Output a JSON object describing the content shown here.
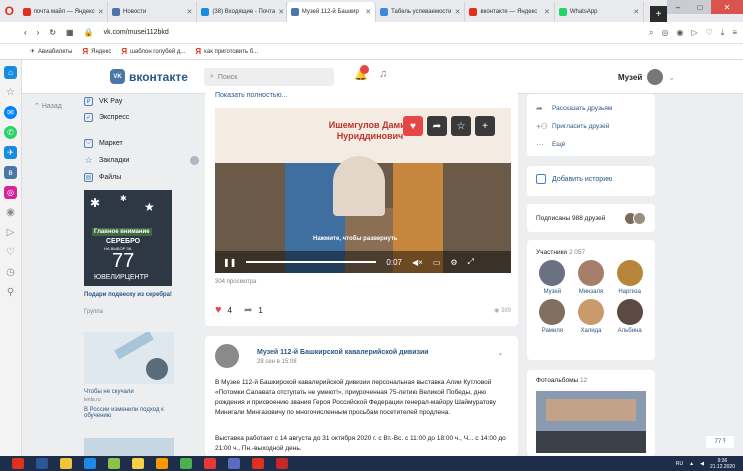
{
  "browser": {
    "tabs": [
      {
        "label": "почта майл — Яндекс",
        "active": false
      },
      {
        "label": "Новости",
        "active": false
      },
      {
        "label": "(38) Входящие - Почта",
        "active": false
      },
      {
        "label": "Музей 112-й Башкир",
        "active": true
      },
      {
        "label": "Табель успеваемости",
        "active": false
      },
      {
        "label": "вконтакте — Яндекс",
        "active": false
      },
      {
        "label": "WhatsApp",
        "active": false
      }
    ],
    "url": "vk.com/musei112bkd",
    "bookmarks": [
      "Авиабилеты",
      "Яндекс",
      "шаблон голубей д...",
      "как приготовить б..."
    ]
  },
  "vk": {
    "logo": "вконтакте",
    "search_placeholder": "Поиск",
    "user_name": "Музей"
  },
  "left_nav": {
    "back": "Назад",
    "items": [
      {
        "label": "VK Pay"
      },
      {
        "label": "Экспресс"
      },
      {
        "label": "Маркет"
      },
      {
        "label": "Закладки"
      },
      {
        "label": "Файлы"
      }
    ]
  },
  "ads": {
    "ad1": {
      "line1": "Главное внимание",
      "line2": "СЕРЕБРО",
      "line3": "НА ВЫБОР ЗА",
      "line4": "77",
      "line5": "ЮВЕЛИРЦЕНТР",
      "title": "Подари подвеску из серебра!",
      "sub": "Группа"
    },
    "ad2": {
      "title": "Чтобы не скучали",
      "sub": "lenta.ru"
    },
    "ad3": {
      "title": "В России изменили подход к обучению"
    }
  },
  "post1": {
    "show_more": "Показать полностью...",
    "video_name": "Ишемгулов Дамир Нуриддинович",
    "video_hint": "Нажмите, чтобы развернуть",
    "time": "0:07",
    "views": "304 просмотра",
    "likes": "4",
    "shares": "1",
    "eye_count": "389"
  },
  "post2": {
    "author": "Музей 112-й Башкирской кавалерийской дивизии",
    "date": "28 сен в 15:08",
    "text": "В Музее 112-й Башкирской кавалерийской дивизии персональная выставка Алии Кутловой «Потомки Салавата отступать не умеют!», приуроченная 75-летию Великой Победы, дню рождения и присвоению звания Героя Российской Федерации генерал-майору Шаймуратову Минигали Мингазовичу по многочисленным просьбам посетителей продлена.",
    "text2": "Выставка работает с 14 августа до 31 октября 2020 г. с Вт.-Вс. с 11:00 до 18:00 ч., Ч... с 14:00 до 21:00 ч., Пн.-выходной день."
  },
  "right": {
    "share": "Рассказать друзьям",
    "invite": "Пригласить друзей",
    "more": "Ещё",
    "add_story": "Добавить историю",
    "subscribed": "Подписаны 988 друзей",
    "participants_label": "Участники",
    "participants_count": "2 057",
    "people": [
      "Музей",
      "Минзаля",
      "Наргиза",
      "Рамиля",
      "Халида",
      "Альбина"
    ],
    "albums_label": "Фотоальбомы",
    "albums_count": "12"
  },
  "zoom_badge": "77",
  "taskbar": {
    "lang": "RU",
    "time": "9:36",
    "date": "21.12.2020"
  }
}
